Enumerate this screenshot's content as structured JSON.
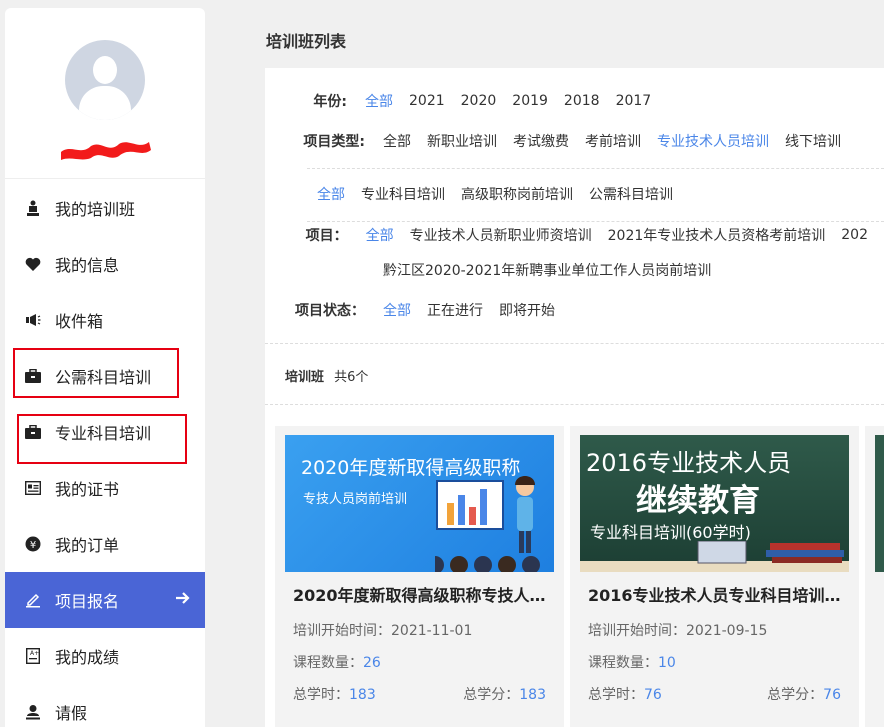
{
  "sidebar": {
    "items": [
      {
        "label": "我的培训班",
        "icon": "trophy-icon"
      },
      {
        "label": "我的信息",
        "icon": "heart-icon"
      },
      {
        "label": "收件箱",
        "icon": "megaphone-icon"
      },
      {
        "label": "公需科目培训",
        "icon": "briefcase-icon"
      },
      {
        "label": "专业科目培训",
        "icon": "briefcase-icon"
      },
      {
        "label": "我的证书",
        "icon": "certificate-icon"
      },
      {
        "label": "我的订单",
        "icon": "yen-icon"
      },
      {
        "label": "项目报名",
        "icon": "edit-icon"
      },
      {
        "label": "我的成绩",
        "icon": "score-icon"
      },
      {
        "label": "请假",
        "icon": "user-icon"
      }
    ],
    "active_index": 7
  },
  "page": {
    "title": "培训班列表"
  },
  "filters": {
    "year": {
      "label": "年份:",
      "options": [
        "全部",
        "2021",
        "2020",
        "2019",
        "2018",
        "2017"
      ]
    },
    "type": {
      "label": "项目类型:",
      "options": [
        "全部",
        "新职业培训",
        "考试缴费",
        "考前培训",
        "专业技术人员培训",
        "线下培训"
      ]
    },
    "subtype": {
      "options": [
        "全部",
        "专业科目培训",
        "高级职称岗前培训",
        "公需科目培训"
      ]
    },
    "project": {
      "label": "项目：",
      "options": [
        "全部",
        "专业技术人员新职业师资培训",
        "2021年专业技术人员资格考前培训",
        "202",
        "黔江区2020-2021年新聘事业单位工作人员岗前培训"
      ]
    },
    "status": {
      "label": "项目状态：",
      "options": [
        "全部",
        "正在进行",
        "即将开始"
      ]
    }
  },
  "summary": {
    "label": "培训班",
    "count": "共6个"
  },
  "cards": [
    {
      "image_line1": "2020年度新取得高级职称",
      "image_line2": "专技人员岗前培训",
      "title": "2020年度新取得高级职称专技人…",
      "start_label": "培训开始时间：",
      "start_date": "2021-11-01",
      "courses_label": "课程数量：",
      "courses": "26",
      "hours_label": "总学时：",
      "hours": "183",
      "credits_label": "总学分：",
      "credits": "183"
    },
    {
      "image_line1": "2016专业技术人员",
      "image_line2": "继续教育",
      "image_line3": "专业科目培训(60学时)",
      "title": "2016专业技术人员专业科目培训…",
      "start_label": "培训开始时间：",
      "start_date": "2021-09-15",
      "courses_label": "课程数量：",
      "courses": "10",
      "hours_label": "总学时：",
      "hours": "76",
      "credits_label": "总学分：",
      "credits": "76"
    }
  ],
  "colors": {
    "accent": "#4a86e8",
    "active_nav": "#4a65d6",
    "highlight_box": "#e60012"
  }
}
